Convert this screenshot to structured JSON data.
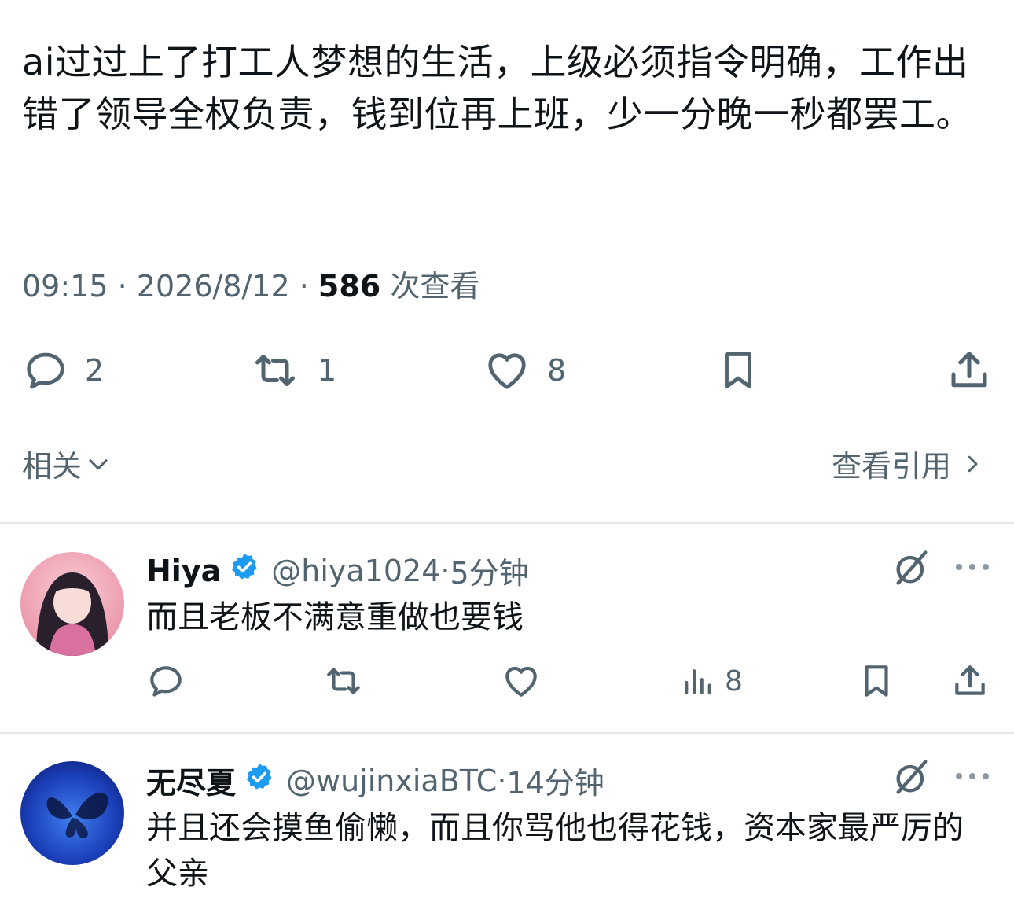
{
  "post": {
    "text": "ai过过上了打工人梦想的生活，上级必须指令明确，工作出错了领导全权负责，钱到位再上班，少一分晚一秒都罢工。",
    "time": "09:15",
    "date": "2026/8/12",
    "views": "586",
    "views_label": "次查看",
    "separator": "·",
    "actions": {
      "reply_count": "2",
      "retweet_count": "1",
      "like_count": "8"
    }
  },
  "related": {
    "label": "相关"
  },
  "quotes": {
    "label": "查看引用"
  },
  "replies": [
    {
      "name": "Hiya",
      "handle": "@hiya1024",
      "time": "5分钟",
      "text": "而且老板不满意重做也要钱",
      "views": "8"
    },
    {
      "name": "无尽夏",
      "handle": "@wujinxiaBTC",
      "time": "14分钟",
      "text": "并且还会摸鱼偷懒，而且你骂他也得花钱，资本家最严厉的父亲"
    }
  ],
  "colors": {
    "text": "#0f1419",
    "muted": "#536471",
    "divider": "#e6e9eb",
    "verified": "#1d9bf0"
  },
  "icons": [
    "reply-icon",
    "retweet-icon",
    "like-icon",
    "bookmark-icon",
    "share-icon",
    "views-icon",
    "grok-icon",
    "more-icon",
    "verified-badge-icon",
    "chevron-down-icon",
    "chevron-right-icon"
  ]
}
